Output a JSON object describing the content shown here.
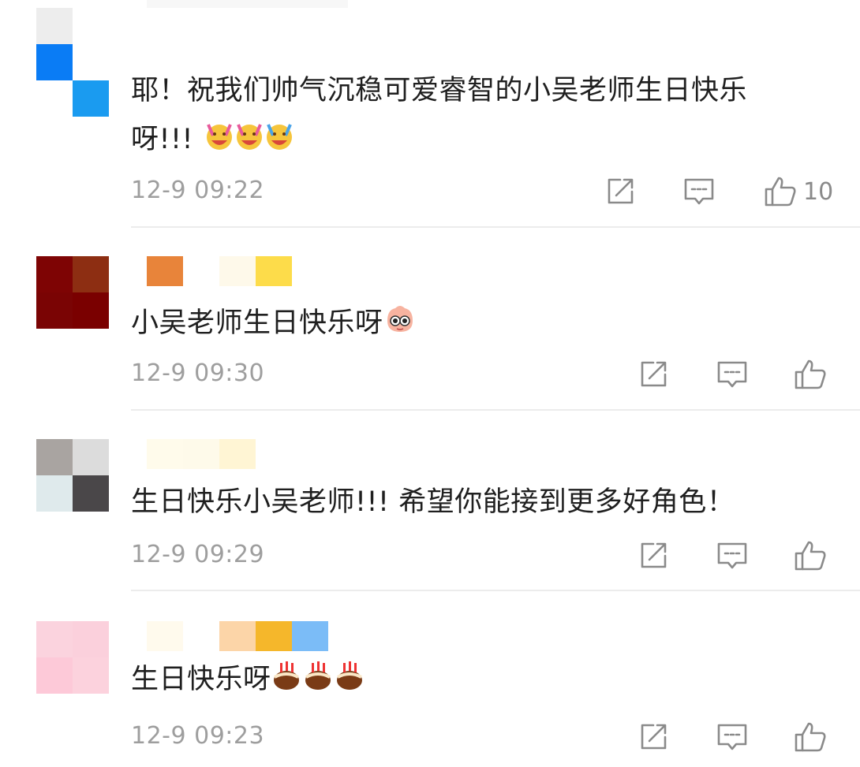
{
  "comments": [
    {
      "avatar_colors": [
        "#ededed",
        "#ffffff",
        "#0a7cf5",
        "#ffffff",
        "#ffffff",
        "#1a9bf0"
      ],
      "username_colors": [],
      "text_line1": "耶！祝我们帅气沉稳可爱睿智的小吴老师生日快乐",
      "text_line2": "呀!!!",
      "emoji": "cheering-emoji",
      "emoji_count": 3,
      "time": "12-9 09:22",
      "like_count": "10"
    },
    {
      "avatar_colors": [
        "#7e0404",
        "#8d2e12",
        "#7a0404",
        "#7a0000"
      ],
      "username_colors": [
        "#e8843a",
        "#ffffff",
        "#fef9ea",
        "#fddc4a"
      ],
      "text": "小吴老师生日快乐呀",
      "emoji": "doge-emoji",
      "time": "12-9 09:30",
      "like_count": ""
    },
    {
      "avatar_colors": [
        "#a9a4a1",
        "#dcdcdc",
        "#dfeaec",
        "#4a4749"
      ],
      "username_colors": [
        "#fffbeb",
        "#fefaea",
        "#fff5d4"
      ],
      "text": "生日快乐小吴老师!!! 希望你能接到更多好角色！",
      "time": "12-9 09:29",
      "like_count": ""
    },
    {
      "avatar_colors": [
        "#fbd3de",
        "#fbd0dc",
        "#fdc9d8",
        "#fcd2dd"
      ],
      "username_colors": [
        "#fffaed",
        "#ffffff",
        "#fcd5a8",
        "#f5b72b",
        "#7bbcf7"
      ],
      "text": "生日快乐呀",
      "emoji": "cake-emoji",
      "emoji_count": 3,
      "time": "12-9 09:23",
      "like_count": ""
    }
  ],
  "icons": {
    "share": "share-icon",
    "reply": "comment-icon",
    "like": "thumbs-up-icon"
  },
  "colors": {
    "text": "#1f1f1f",
    "meta": "#9e9e9e",
    "icon": "#8a8a8a",
    "divider": "#ececec"
  }
}
